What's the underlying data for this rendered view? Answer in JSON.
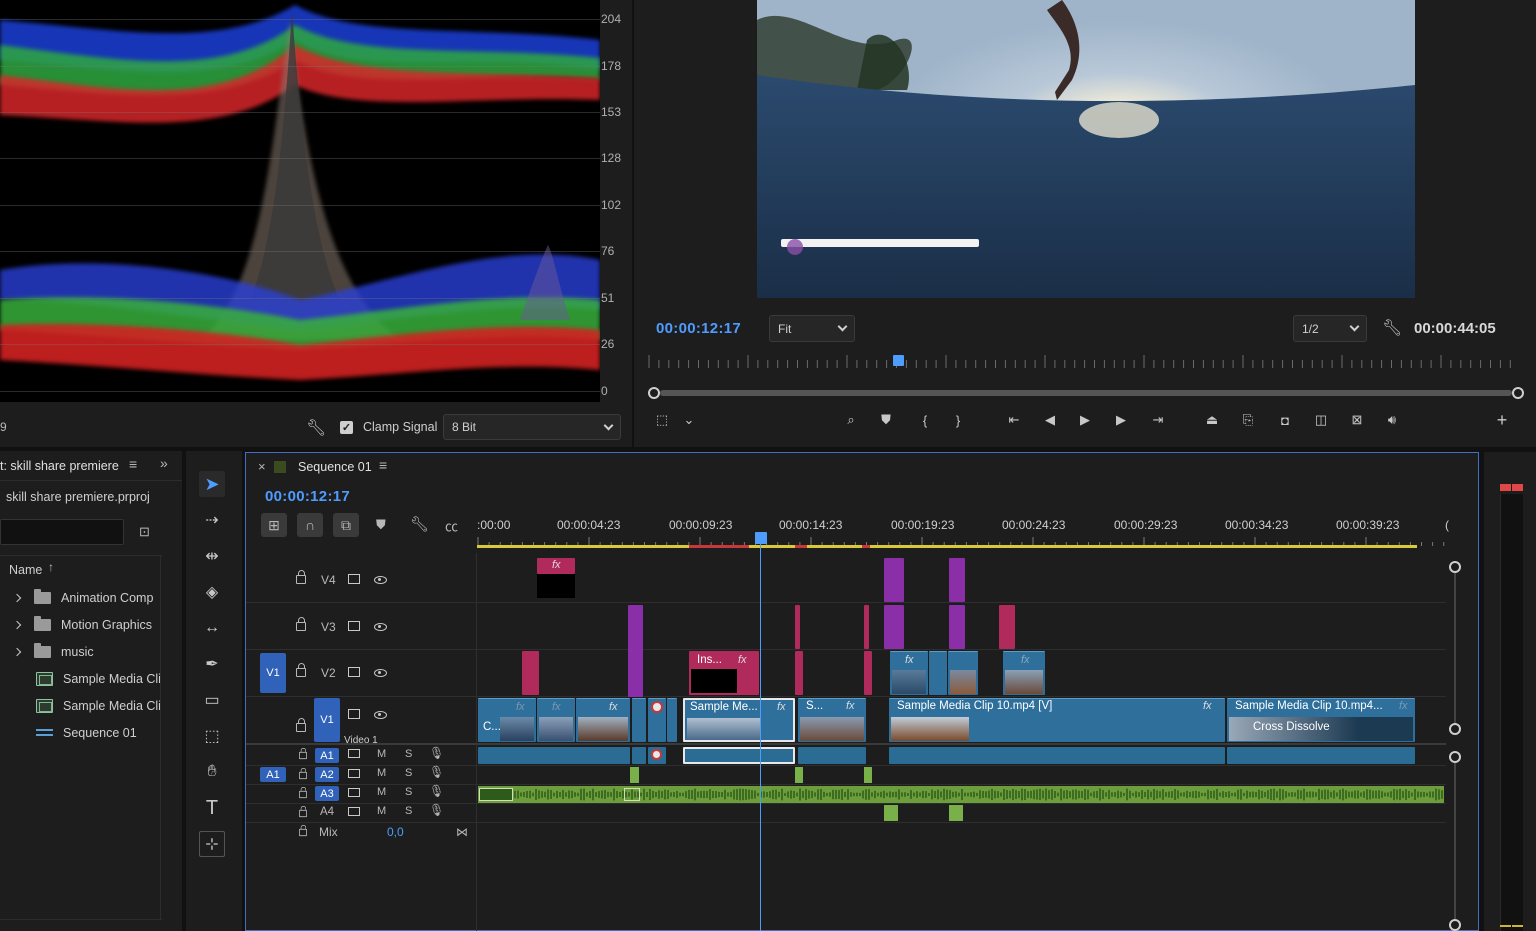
{
  "scopes": {
    "scale": [
      "204",
      "178",
      "153",
      "128",
      "102",
      "76",
      "51",
      "26",
      "0"
    ],
    "left_value": "9",
    "clamp_signal_label": "Clamp Signal",
    "bit_depth": "8 Bit"
  },
  "program": {
    "current_timecode": "00:00:12:17",
    "fit_label": "Fit",
    "resolution": "1/2",
    "duration_timecode": "00:00:44:05"
  },
  "project": {
    "title": "t: skill share premiere",
    "file": "skill share premiere.prproj",
    "name_header": "Name",
    "items": [
      {
        "label": "Animation Comp",
        "type": "folder"
      },
      {
        "label": "Motion Graphics",
        "type": "folder"
      },
      {
        "label": "music",
        "type": "folder"
      },
      {
        "label": "Sample Media Cli",
        "type": "clip"
      },
      {
        "label": "Sample Media Cli",
        "type": "clip"
      },
      {
        "label": "Sequence 01",
        "type": "sequence"
      }
    ]
  },
  "timeline": {
    "sequence_title": "Sequence 01",
    "timecode": "00:00:12:17",
    "ruler": [
      ":00:00",
      "00:00:04:23",
      "00:00:09:23",
      "00:00:14:23",
      "00:00:19:23",
      "00:00:24:23",
      "00:00:29:23",
      "00:00:34:23",
      "00:00:39:23",
      "("
    ],
    "video_tracks": [
      "V4",
      "V3",
      "V2",
      "V1"
    ],
    "v1_name": "Video 1",
    "audio_tracks": [
      "A1",
      "A2",
      "A3",
      "A4"
    ],
    "mute": "M",
    "solo": "S",
    "mix_label": "Mix",
    "mix_value": "0,0",
    "source_v1": "V1",
    "source_a1": "A1",
    "clips": {
      "inset": "Ins...",
      "sample_short": "Sample Me...",
      "s_short": "S...",
      "c_short": "C...",
      "sample_10_v": "Sample Media Clip 10.mp4 [V]",
      "sample_10_b": "Sample Media Clip 10.mp4...",
      "cross_dissolve": "Cross Dissolve",
      "fx": "fx"
    }
  },
  "colors": {
    "accent_blue": "#4f9cff",
    "track_blue": "#2f62b8",
    "clip_pink": "#b02a5b",
    "clip_purple": "#8a2fa8",
    "audio_green": "#6c9f3c"
  }
}
